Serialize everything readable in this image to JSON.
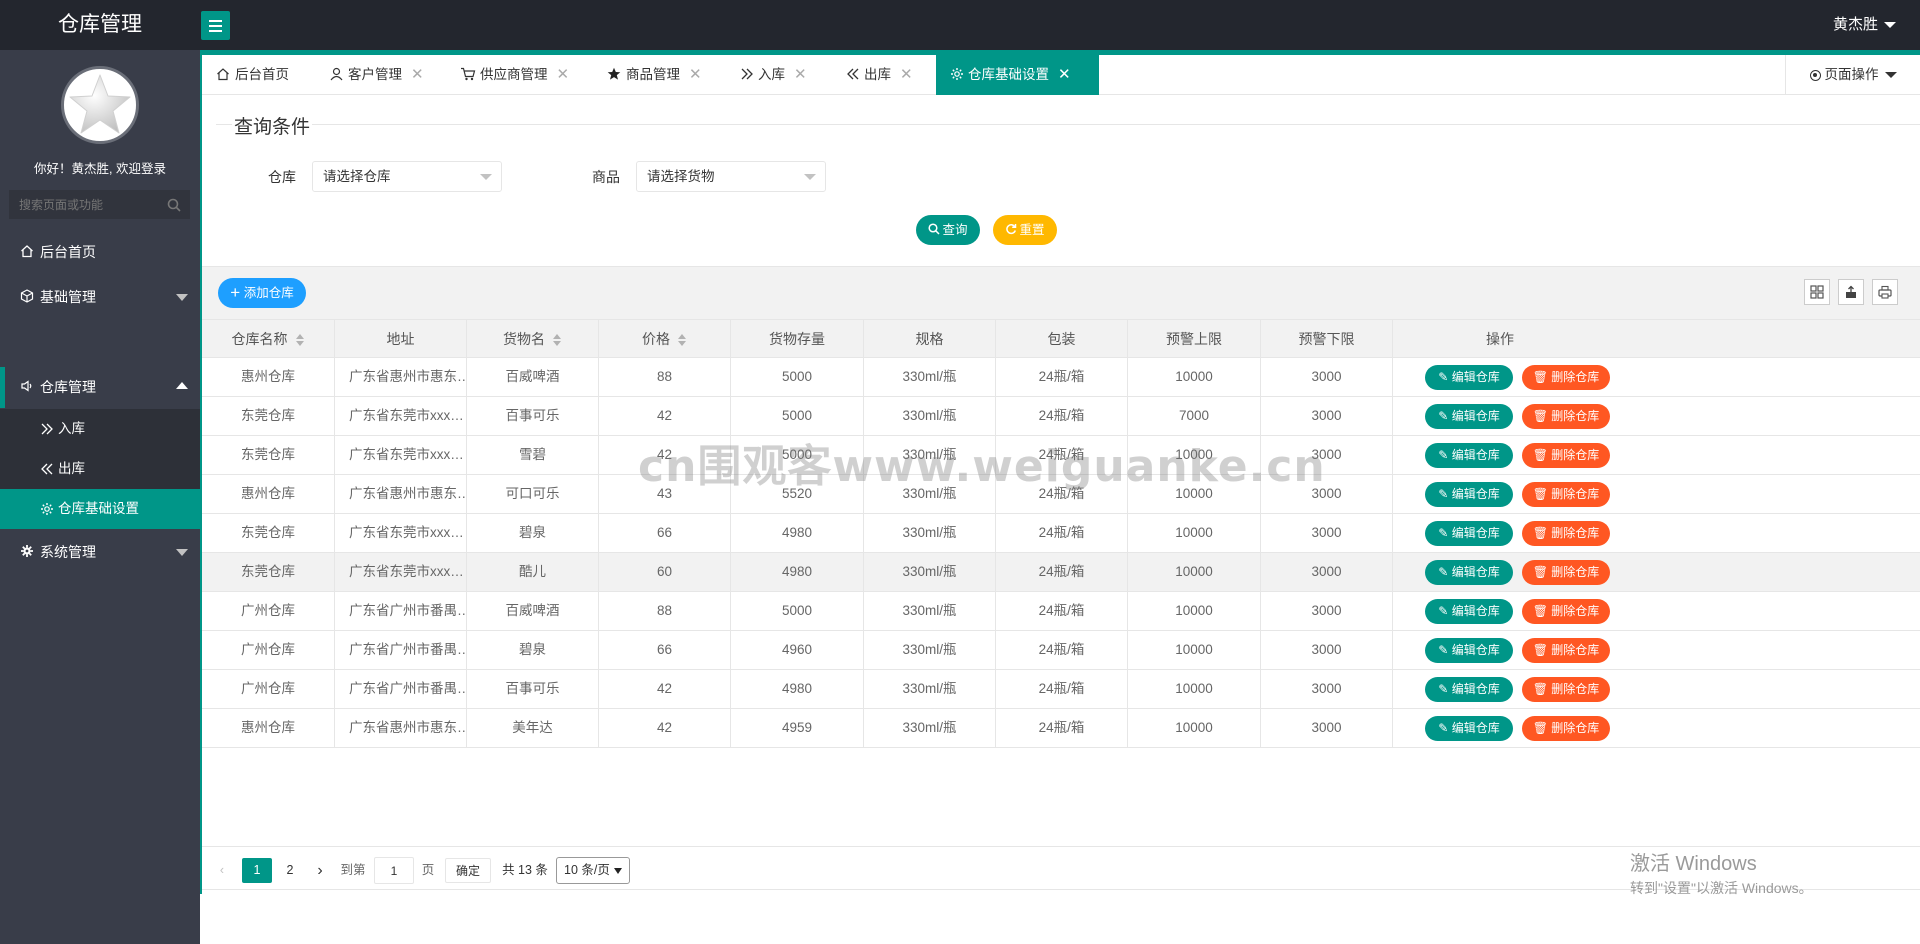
{
  "app": {
    "title": "仓库管理",
    "user": "黄杰胜",
    "greeting": "你好！黄杰胜, 欢迎登录"
  },
  "colors": {
    "primary": "#009688",
    "danger": "#ff5722",
    "warning": "#ffb800",
    "info": "#1e9fff",
    "sidebar": "#393d49",
    "topbar": "#23262e"
  },
  "sidebar": {
    "search_placeholder": "搜索页面或功能",
    "nav": [
      {
        "label": "后台首页",
        "icon": "home-icon"
      },
      {
        "label": "基础管理",
        "icon": "cube-icon"
      },
      {
        "label": "仓库管理",
        "icon": "speaker-icon"
      },
      {
        "label": "系统管理",
        "icon": "gear-icon"
      }
    ],
    "sub": [
      {
        "label": "入库",
        "icon": "double-right-icon"
      },
      {
        "label": "出库",
        "icon": "double-left-icon"
      },
      {
        "label": "仓库基础设置",
        "icon": "gear-icon"
      }
    ]
  },
  "tabs": [
    {
      "label": "后台首页",
      "icon": "home-icon"
    },
    {
      "label": "客户管理",
      "icon": "user-icon"
    },
    {
      "label": "供应商管理",
      "icon": "cart-icon"
    },
    {
      "label": "商品管理",
      "icon": "star-icon"
    },
    {
      "label": "入库",
      "icon": "double-right-icon"
    },
    {
      "label": "出库",
      "icon": "double-left-icon"
    },
    {
      "label": "仓库基础设置",
      "icon": "gear-icon",
      "active": true
    }
  ],
  "tab_close": "✕",
  "page_ops": "页面操作",
  "query": {
    "legend": "查询条件",
    "warehouse_label": "仓库",
    "warehouse_value": "请选择仓库",
    "goods_label": "商品",
    "goods_value": "请选择货物",
    "search_btn": "查询",
    "reset_btn": "重置"
  },
  "toolbar": {
    "add_btn": "添加仓库"
  },
  "table": {
    "headers": [
      "仓库名称",
      "地址",
      "货物名",
      "价格",
      "货物存量",
      "规格",
      "包装",
      "预警上限",
      "预警下限",
      "操作"
    ],
    "rows": [
      [
        "惠州仓库",
        "广东省惠州市惠东…",
        "百威啤酒",
        "88",
        "5000",
        "330ml/瓶",
        "24瓶/箱",
        "10000",
        "3000"
      ],
      [
        "东莞仓库",
        "广东省东莞市xxx…",
        "百事可乐",
        "42",
        "5000",
        "330ml/瓶",
        "24瓶/箱",
        "7000",
        "3000"
      ],
      [
        "东莞仓库",
        "广东省东莞市xxx…",
        "雪碧",
        "42",
        "5000",
        "330ml/瓶",
        "24瓶/箱",
        "10000",
        "3000"
      ],
      [
        "惠州仓库",
        "广东省惠州市惠东…",
        "可口可乐",
        "43",
        "5520",
        "330ml/瓶",
        "24瓶/箱",
        "10000",
        "3000"
      ],
      [
        "东莞仓库",
        "广东省东莞市xxx…",
        "碧泉",
        "66",
        "4980",
        "330ml/瓶",
        "24瓶/箱",
        "10000",
        "3000"
      ],
      [
        "东莞仓库",
        "广东省东莞市xxx…",
        "酷儿",
        "60",
        "4980",
        "330ml/瓶",
        "24瓶/箱",
        "10000",
        "3000"
      ],
      [
        "广州仓库",
        "广东省广州市番禺…",
        "百威啤酒",
        "88",
        "5000",
        "330ml/瓶",
        "24瓶/箱",
        "10000",
        "3000"
      ],
      [
        "广州仓库",
        "广东省广州市番禺…",
        "碧泉",
        "66",
        "4960",
        "330ml/瓶",
        "24瓶/箱",
        "10000",
        "3000"
      ],
      [
        "广州仓库",
        "广东省广州市番禺…",
        "百事可乐",
        "42",
        "4980",
        "330ml/瓶",
        "24瓶/箱",
        "10000",
        "3000"
      ],
      [
        "惠州仓库",
        "广东省惠州市惠东…",
        "美年达",
        "42",
        "4959",
        "330ml/瓶",
        "24瓶/箱",
        "10000",
        "3000"
      ]
    ],
    "edit_btn": "编辑仓库",
    "delete_btn": "删除仓库"
  },
  "pagination": {
    "pages": [
      "1",
      "2"
    ],
    "current": "1",
    "goto_label": "到第",
    "goto_value": "1",
    "page_unit": "页",
    "confirm": "确定",
    "total": "共 13 条",
    "page_size": "10 条/页"
  },
  "watermark": "cn围观客www.weiguanke.cn",
  "windows": {
    "line1": "激活 Windows",
    "line2": "转到\"设置\"以激活 Windows。"
  }
}
